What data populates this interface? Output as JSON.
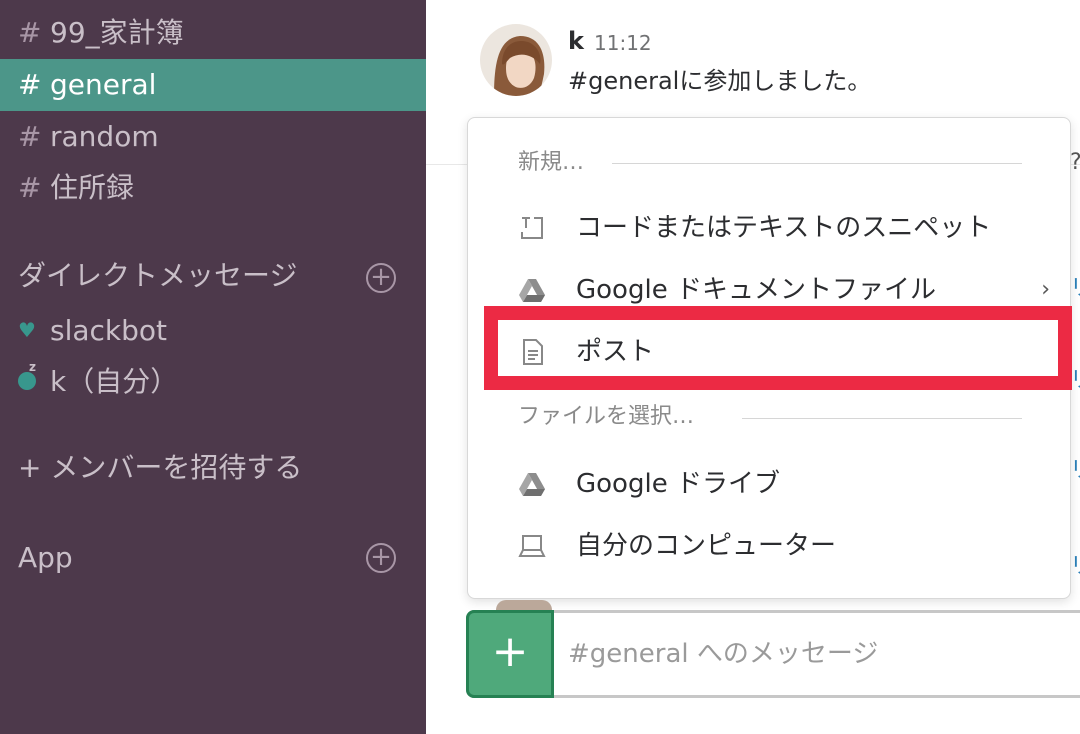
{
  "sidebar": {
    "channels": [
      {
        "hash": "#",
        "name": "99_家計簿",
        "active": false
      },
      {
        "hash": "#",
        "name": "general",
        "active": true
      },
      {
        "hash": "#",
        "name": "random",
        "active": false
      },
      {
        "hash": "#",
        "name": "住所録",
        "active": false
      }
    ],
    "dm_header": "ダイレクトメッセージ",
    "dms": [
      {
        "name": "slackbot",
        "icon": "heart-icon"
      },
      {
        "name": "k（自分）",
        "icon": "away-moon-icon"
      }
    ],
    "invite_label": "+ メンバーを招待する",
    "apps_header": "App"
  },
  "message": {
    "author": "k",
    "time": "11:12",
    "text": "#generalに参加しました。"
  },
  "menu": {
    "new_header": "新規…",
    "items_new": [
      {
        "label": "コードまたはテキストのスニペット",
        "icon": "snippet-icon"
      },
      {
        "label": "Google ドキュメントファイル",
        "icon": "google-drive-icon",
        "submenu": true
      },
      {
        "label": "ポスト",
        "icon": "post-document-icon",
        "highlighted": true
      }
    ],
    "file_header": "ファイルを選択…",
    "items_file": [
      {
        "label": "Google ドライブ",
        "icon": "google-drive-icon"
      },
      {
        "label": "自分のコンピューター",
        "icon": "computer-icon"
      }
    ],
    "chevron": "›"
  },
  "composer": {
    "add_label": "+",
    "placeholder": "#general へのメッセージ"
  },
  "colors": {
    "sidebar_bg": "#4d394b",
    "active_channel": "#4c9689",
    "highlight_box": "#ec2a44",
    "add_button": "#4fa97b"
  }
}
